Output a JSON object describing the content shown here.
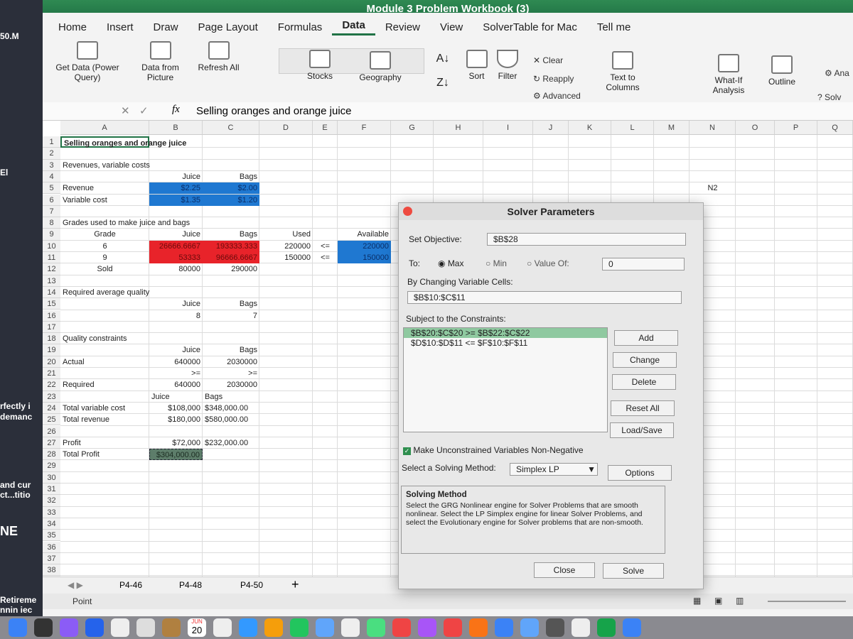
{
  "background_windows": [
    "50.M",
    "El",
    "rfectly i",
    "demanc",
    "and cur",
    "ct...titio",
    "NE",
    "Retireme",
    "nnin iec"
  ],
  "window_title": "Module 3 Problem Workbook (3)",
  "tabs": [
    "Home",
    "Insert",
    "Draw",
    "Page Layout",
    "Formulas",
    "Data",
    "Review",
    "View",
    "SolverTable for Mac",
    "Tell me"
  ],
  "active_tab": "Data",
  "ribbon": {
    "get_data": "Get Data (Power Query)",
    "data_from_picture": "Data from Picture",
    "refresh_all": "Refresh All",
    "stocks": "Stocks",
    "geography": "Geography",
    "sort": "Sort",
    "filter": "Filter",
    "clear": "Clear",
    "reapply": "Reapply",
    "advanced": "Advanced",
    "text_to_columns": "Text to Columns",
    "what_if": "What-If Analysis",
    "outline": "Outline",
    "analysis": "Ana",
    "solver": "Solv"
  },
  "formula_bar": {
    "fx": "fx",
    "content": "Selling oranges and orange juice"
  },
  "columns": [
    "A",
    "B",
    "C",
    "D",
    "E",
    "F",
    "G",
    "H",
    "I",
    "J",
    "K",
    "L",
    "M",
    "N",
    "O",
    "P",
    "Q"
  ],
  "cells": [
    {
      "ref": "A1",
      "v": "Selling oranges and orange juice",
      "s": "bold sel"
    },
    {
      "ref": "A3",
      "v": "Revenues, variable costs"
    },
    {
      "ref": "B4",
      "v": "Juice",
      "s": "r"
    },
    {
      "ref": "C4",
      "v": "Bags",
      "s": "r"
    },
    {
      "ref": "A5",
      "v": "Revenue"
    },
    {
      "ref": "B5",
      "v": "$2.25",
      "s": "r blue"
    },
    {
      "ref": "C5",
      "v": "$2.00",
      "s": "r blue"
    },
    {
      "ref": "A6",
      "v": "Variable cost"
    },
    {
      "ref": "B6",
      "v": "$1.35",
      "s": "r blue"
    },
    {
      "ref": "C6",
      "v": "$1.20",
      "s": "r blue"
    },
    {
      "ref": "A8",
      "v": "Grades used to make juice and bags"
    },
    {
      "ref": "A9",
      "v": "Grade",
      "s": "c"
    },
    {
      "ref": "B9",
      "v": "Juice",
      "s": "r"
    },
    {
      "ref": "C9",
      "v": "Bags",
      "s": "r"
    },
    {
      "ref": "D9",
      "v": "Used",
      "s": "r"
    },
    {
      "ref": "F9",
      "v": "Available",
      "s": "r"
    },
    {
      "ref": "A10",
      "v": "6",
      "s": "c"
    },
    {
      "ref": "B10",
      "v": "26666.6667",
      "s": "r red"
    },
    {
      "ref": "C10",
      "v": "193333.333",
      "s": "r red"
    },
    {
      "ref": "D10",
      "v": "220000",
      "s": "r"
    },
    {
      "ref": "E10",
      "v": "<=",
      "s": "c"
    },
    {
      "ref": "F10",
      "v": "220000",
      "s": "r blue"
    },
    {
      "ref": "A11",
      "v": "9",
      "s": "c"
    },
    {
      "ref": "B11",
      "v": "53333",
      "s": "r red"
    },
    {
      "ref": "C11",
      "v": "96666.6667",
      "s": "r red"
    },
    {
      "ref": "D11",
      "v": "150000",
      "s": "r"
    },
    {
      "ref": "E11",
      "v": "<=",
      "s": "c"
    },
    {
      "ref": "F11",
      "v": "150000",
      "s": "r blue"
    },
    {
      "ref": "A12",
      "v": "Sold",
      "s": "c"
    },
    {
      "ref": "B12",
      "v": "80000",
      "s": "r"
    },
    {
      "ref": "C12",
      "v": "290000",
      "s": "r"
    },
    {
      "ref": "A14",
      "v": "Required average quality"
    },
    {
      "ref": "B15",
      "v": "Juice",
      "s": "r"
    },
    {
      "ref": "C15",
      "v": "Bags",
      "s": "r"
    },
    {
      "ref": "B16",
      "v": "8",
      "s": "r"
    },
    {
      "ref": "C16",
      "v": "7",
      "s": "r"
    },
    {
      "ref": "A18",
      "v": "Quality constraints"
    },
    {
      "ref": "B19",
      "v": "Juice",
      "s": "r"
    },
    {
      "ref": "C19",
      "v": "Bags",
      "s": "r"
    },
    {
      "ref": "A20",
      "v": "Actual"
    },
    {
      "ref": "B20",
      "v": "640000",
      "s": "r"
    },
    {
      "ref": "C20",
      "v": "2030000",
      "s": "r"
    },
    {
      "ref": "B21",
      "v": ">=",
      "s": "r"
    },
    {
      "ref": "C21",
      "v": ">=",
      "s": "r"
    },
    {
      "ref": "A22",
      "v": "Required"
    },
    {
      "ref": "B22",
      "v": "640000",
      "s": "r"
    },
    {
      "ref": "C22",
      "v": "2030000",
      "s": "r"
    },
    {
      "ref": "B23",
      "v": "Juice"
    },
    {
      "ref": "C23",
      "v": "Bags"
    },
    {
      "ref": "A24",
      "v": "Total variable cost"
    },
    {
      "ref": "B24",
      "v": "$108,000",
      "s": "r"
    },
    {
      "ref": "C24",
      "v": "$348,000.00"
    },
    {
      "ref": "A25",
      "v": "Total revenue"
    },
    {
      "ref": "B25",
      "v": "$180,000",
      "s": "r"
    },
    {
      "ref": "C25",
      "v": "$580,000.00"
    },
    {
      "ref": "A27",
      "v": "Profit"
    },
    {
      "ref": "B27",
      "v": "$72,000",
      "s": "r"
    },
    {
      "ref": "C27",
      "v": "$232,000.00"
    },
    {
      "ref": "A28",
      "v": "Total Profit"
    },
    {
      "ref": "B28",
      "v": "$304,000.00",
      "s": "r tp"
    },
    {
      "ref": "N5",
      "v": "N2",
      "s": "c"
    }
  ],
  "sheet_tabs": [
    "P4-46",
    "P4-48",
    "P4-50"
  ],
  "status": "Point",
  "dock_calendar": {
    "month": "JUN",
    "day": "20"
  },
  "solver": {
    "title": "Solver Parameters",
    "set_objective_label": "Set Objective:",
    "set_objective": "$B$28",
    "to_label": "To:",
    "max": "Max",
    "min": "Min",
    "value_of": "Value Of:",
    "value_of_value": "0",
    "selected": "Max",
    "changing_label": "By Changing Variable Cells:",
    "changing": "$B$10:$C$11",
    "constraints_label": "Subject to the Constraints:",
    "constraints": [
      "$B$20:$C$20 >= $B$22:$C$22",
      "$D$10:$D$11 <= $F$10:$F$11"
    ],
    "buttons": {
      "add": "Add",
      "change": "Change",
      "delete": "Delete",
      "reset_all": "Reset All",
      "load_save": "Load/Save",
      "options": "Options",
      "close": "Close",
      "solve": "Solve"
    },
    "nonneg_label": "Make Unconstrained Variables Non-Negative",
    "nonneg_checked": true,
    "method_label": "Select a Solving Method:",
    "method": "Simplex LP",
    "info_title": "Solving Method",
    "info_text": "Select the GRG Nonlinear engine for Solver Problems that are smooth nonlinear. Select the LP Simplex engine for linear Solver Problems, and select the Evolutionary engine for Solver problems that are non-smooth."
  },
  "colors": {
    "excel_green": "#217346",
    "input_blue": "#1f78d1",
    "changing_red": "#e8232a",
    "selected_constraint": "#8fc9a0"
  }
}
